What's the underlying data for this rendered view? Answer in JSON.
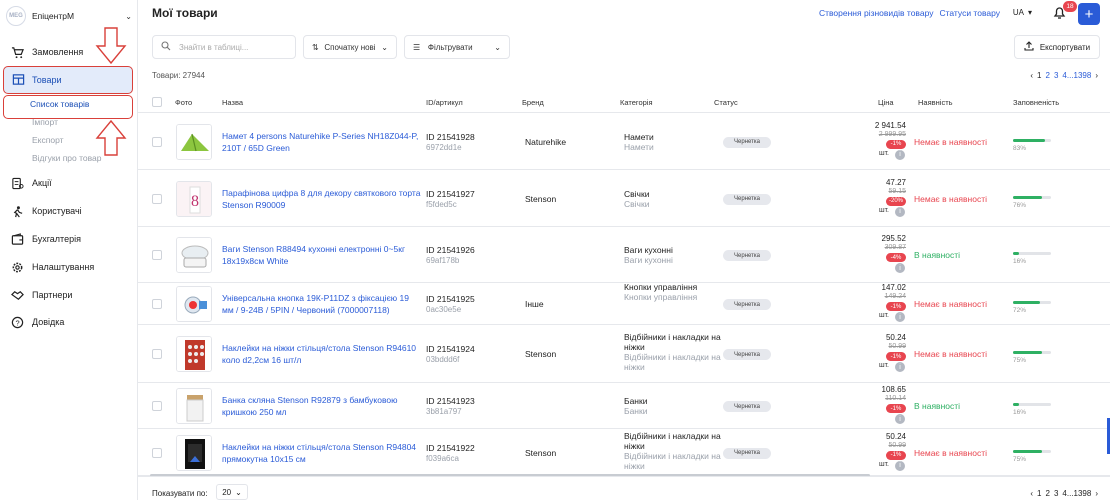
{
  "sidebar": {
    "shop_logo": "MEG",
    "shop_name": "ЕпіцентрМ",
    "items": [
      {
        "label": "Замовлення",
        "icon": "cart-icon"
      },
      {
        "label": "Товари",
        "icon": "box-icon"
      },
      {
        "label": "Акції",
        "icon": "tag-icon"
      },
      {
        "label": "Користувачі",
        "icon": "users-icon"
      },
      {
        "label": "Бухгалтерія",
        "icon": "wallet-icon"
      },
      {
        "label": "Налаштування",
        "icon": "gear-icon"
      },
      {
        "label": "Партнери",
        "icon": "handshake-icon"
      },
      {
        "label": "Довідка",
        "icon": "help-icon"
      }
    ],
    "sub": [
      "Список товарів",
      "Імпорт",
      "Експорт",
      "Відгуки про товар"
    ]
  },
  "header": {
    "title": "Мої товари",
    "link1": "Створення різновидів товару",
    "link2": "Статуси товару",
    "lang": "UA",
    "notif_count": "18"
  },
  "toolbar": {
    "search_placeholder": "Знайти в таблиці...",
    "sort_label": "Спочатку нові",
    "filter_label": "Фільтрувати",
    "export_label": "Експортувати"
  },
  "count_label": "Товари: 27944",
  "pagination": {
    "pages": [
      "1",
      "2",
      "3",
      "4...1398"
    ],
    "current": "1"
  },
  "columns": [
    "Фото",
    "Назва",
    "ID/артикул",
    "Бренд",
    "Категорія",
    "Статус",
    "Ціна",
    "Наявність",
    "Заповненість"
  ],
  "rows": [
    {
      "name": "Намет 4 persons Naturehike P-Series NH18Z044-P, 210T / 65D Green",
      "id": "ID 21541928",
      "hash": "6972dd1e",
      "brand": "Naturehike",
      "cat1": "Намети",
      "cat2": "Намети",
      "status": "Чернетка",
      "price": "2 941.54",
      "old": "2 999.95",
      "disc": "-1%",
      "unit": "шт.",
      "avail": "Немає в наявності",
      "avail_color": "#e8454f",
      "fill": 0.83,
      "pct": "83%"
    },
    {
      "name": "Парафінова цифра 8 для декору святкового торта Stenson R90009",
      "id": "ID 21541927",
      "hash": "f5fded5c",
      "brand": "Stenson",
      "cat1": "Свічки",
      "cat2": "Свічки",
      "status": "Чернетка",
      "price": "47.27",
      "old": "59.15",
      "disc": "-20%",
      "unit": "шт.",
      "avail": "Немає в наявності",
      "avail_color": "#e8454f",
      "fill": 0.76,
      "pct": "76%"
    },
    {
      "name": "Ваги Stenson R88494 кухонні електронні 0~5кг 18х19х8см White",
      "id": "ID 21541926",
      "hash": "69af178b",
      "brand": "",
      "cat1": "Ваги кухонні",
      "cat2": "Ваги кухонні",
      "status": "Чернетка",
      "price": "295.52",
      "old": "309.87",
      "disc": "-4%",
      "unit": "",
      "avail": "В наявності",
      "avail_color": "#2eb063",
      "fill": 0.16,
      "pct": "16%"
    },
    {
      "name": "Універсальна кнопка 19К-P11DZ з фіксацією 19 мм / 9-24В / 5PIN / Червоний (7000007118)",
      "id": "ID 21541925",
      "hash": "0ac30e5e",
      "brand": "Інше",
      "cat1": "Кнопки управління",
      "cat2": "Кнопки управління",
      "status": "Чернетка",
      "price": "147.02",
      "old": "149.24",
      "disc": "-1%",
      "unit": "шт.",
      "avail": "Немає в наявності",
      "avail_color": "#e8454f",
      "fill": 0.72,
      "pct": "72%"
    },
    {
      "name": "Наклейки на ніжки стільця/стола Stenson R94610 коло d2,2см 16 шт/л",
      "id": "ID 21541924",
      "hash": "03bddd6f",
      "brand": "Stenson",
      "cat1": "Відбійники і накладки на ніжки",
      "cat2": "Відбійники і накладки на ніжки",
      "status": "Чернетка",
      "price": "50.24",
      "old": "50.99",
      "disc": "-1%",
      "unit": "шт.",
      "avail": "Немає в наявності",
      "avail_color": "#e8454f",
      "fill": 0.75,
      "pct": "75%"
    },
    {
      "name": "Банка скляна Stenson R92879 з бамбуковою кришкою 250 мл",
      "id": "ID 21541923",
      "hash": "3b81a797",
      "brand": "",
      "cat1": "Банки",
      "cat2": "Банки",
      "status": "Чернетка",
      "price": "108.65",
      "old": "110.14",
      "disc": "-1%",
      "unit": "",
      "avail": "В наявності",
      "avail_color": "#2eb063",
      "fill": 0.16,
      "pct": "16%"
    },
    {
      "name": "Наклейки на ніжки стільця/стола Stenson R94804 прямокутна 10х15 см",
      "id": "ID 21541922",
      "hash": "f039a6ca",
      "brand": "Stenson",
      "cat1": "Відбійники і накладки на ніжки",
      "cat2": "Відбійники і накладки на ніжки",
      "status": "Чернетка",
      "price": "50.24",
      "old": "50.99",
      "disc": "-1%",
      "unit": "шт.",
      "avail": "Немає в наявності",
      "avail_color": "#e8454f",
      "fill": 0.75,
      "pct": "75%"
    }
  ],
  "footer": {
    "show_label": "Показувати по:",
    "page_size": "20"
  }
}
